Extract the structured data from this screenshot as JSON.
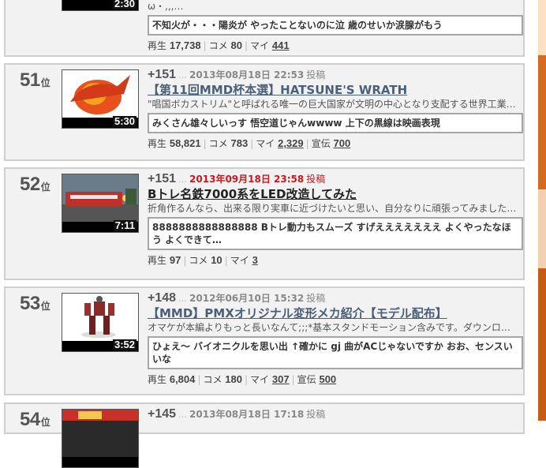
{
  "colors": {
    "accent_red": "#c8191e",
    "title_link": "#4a5f7c",
    "card_border": "#cfcfcf"
  },
  "top_partial": {
    "duration": "2:30",
    "desc": "ω・,,,…",
    "comment": "不知火が・・・陽炎が やったことないのに泣 歳のせいか涙腺がもう",
    "stats": {
      "views_label": "再生",
      "views": "17,738",
      "comments_label": "コメ",
      "comments": "80",
      "mylist_label": "マイ",
      "mylist": "441"
    }
  },
  "items": [
    {
      "rank": "51",
      "rank_suffix": "位",
      "duration": "5:30",
      "points": "+151",
      "dots": "…",
      "date": "2013年08月18日 22:53",
      "posted": "投稿",
      "title": "【第11回MMD杯本選】HATSUNE'S WRATH",
      "desc": "\"唱国ボカストリム\"と呼ばれる唯一の巨大国家が文明の中心となり支配する世界工業…",
      "comment": "みくさん雄々しいっす 悟空道じゃんwwww 上下の黒線は映画表現",
      "stats": {
        "views_label": "再生",
        "views": "58,821",
        "comments_label": "コメ",
        "comments": "783",
        "mylist_label": "マイ",
        "mylist": "2,329",
        "ad_label": "宣伝",
        "ad": "700"
      }
    },
    {
      "rank": "52",
      "rank_suffix": "位",
      "duration": "7:11",
      "points": "+151",
      "dots": "…",
      "date": "2013年09月18日 23:58",
      "posted": "投稿",
      "title": "Bトレ名鉄7000系をLED改造してみた",
      "desc": "折角作るんなら、出来る限り実車に近づけたいと思い、自分なりに頑張ってみました…",
      "comment": "8888888888888888 Bトレ動力もスムーズ すげえええええええ よくやったなほう よくできて…",
      "stats": {
        "views_label": "再生",
        "views": "97",
        "comments_label": "コメ",
        "comments": "10",
        "mylist_label": "マイ",
        "mylist": "3"
      }
    },
    {
      "rank": "53",
      "rank_suffix": "位",
      "duration": "3:52",
      "points": "+148",
      "dots": "…",
      "date": "2012年06月10日 15:32",
      "posted": "投稿",
      "title": "【MMD】PMXオリジナル変形メカ紹介【モデル配布】",
      "desc": "オマケが本編よりもっと長いなんて;;;*基本スタンドモーション含みです。ダウンロ…",
      "comment": "ひょえ～ バイオニクルを思い出 ↑確かに gj 曲がACじゃないですか おお、センスいいな",
      "stats": {
        "views_label": "再生",
        "views": "6,804",
        "comments_label": "コメ",
        "comments": "180",
        "mylist_label": "マイ",
        "mylist": "307",
        "ad_label": "宣伝",
        "ad": "500"
      }
    },
    {
      "rank": "54",
      "rank_suffix": "位",
      "points": "+145",
      "dots": "…",
      "date": "2013年08月18日 17:18",
      "posted": "投稿"
    }
  ]
}
